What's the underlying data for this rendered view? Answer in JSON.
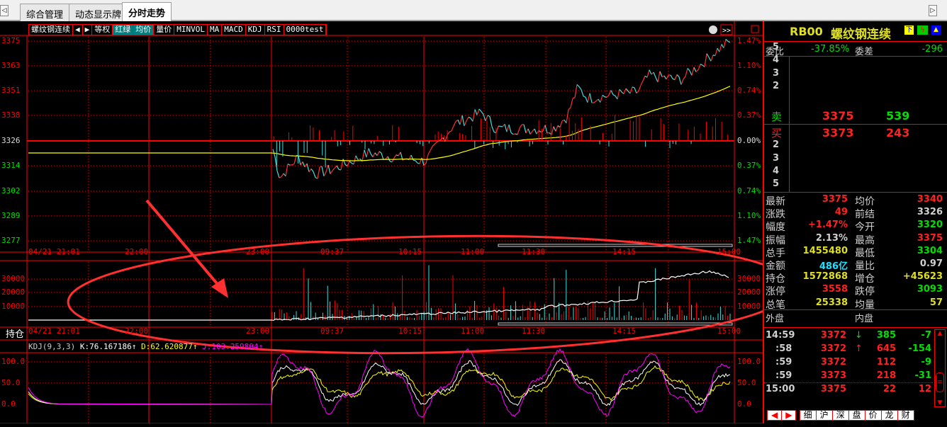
{
  "tabs": [
    "综合管理",
    "动态显示牌",
    "分时走势"
  ],
  "active_tab": 2,
  "toolbar": {
    "items": [
      "螺纹钢连续",
      "◀",
      "▶",
      "等权",
      "红绿",
      "均价",
      "量价",
      "MINVOL",
      "MA",
      "MACD",
      "KDJ",
      "RSI",
      "0000test"
    ]
  },
  "price_axis": {
    "left": [
      "3375",
      "3363",
      "3351",
      "3338",
      "3326",
      "3314",
      "3302",
      "3289",
      "3277"
    ],
    "right": [
      "1.47%",
      "1.10%",
      "0.74%",
      "0.37%",
      "0.00%",
      "0.37%",
      "0.74%",
      "1.10%",
      "1.47%"
    ]
  },
  "time_axis": [
    "04/21 21:01",
    "22:00",
    "23:00",
    "09:37",
    "10:15",
    "11:00",
    "11:30",
    "14:15",
    "15:00"
  ],
  "volume_axis": [
    "30000",
    "20000",
    "10000"
  ],
  "volume_label": "持仓",
  "kdj": {
    "title": "KDJ(9,3,3)",
    "k": "K:76.167186",
    "d": "D:62.620877",
    "j": "J:103.259804",
    "axis": [
      "100.0",
      "50.0",
      "0.0"
    ]
  },
  "quote": {
    "code": "RB00",
    "name": "螺纹钢连续",
    "wei_bi_label": "委比",
    "wei_bi": "-37.85%",
    "wei_cha_label": "委差",
    "wei_cha": "-296",
    "sell_levels": [
      "5",
      "4",
      "3",
      "2"
    ],
    "sell_label": "卖",
    "sell_price": "3375",
    "sell_vol": "539",
    "buy_label": "买",
    "buy_price": "3373",
    "buy_vol": "243",
    "buy_levels": [
      "2",
      "3",
      "4",
      "5"
    ],
    "stats": [
      [
        "最新",
        "3375",
        "均价",
        "3340"
      ],
      [
        "涨跌",
        "49",
        "前结",
        "3326"
      ],
      [
        "幅度",
        "+1.47%",
        "今开",
        "3320"
      ],
      [
        "振幅",
        "2.13%",
        "最高",
        "3375"
      ],
      [
        "总手",
        "1455480",
        "最低",
        "3304"
      ],
      [
        "金额",
        "486亿",
        "量比",
        "0.97"
      ],
      [
        "持仓",
        "1572868",
        "增仓",
        "+45623"
      ],
      [
        "涨停",
        "3558",
        "跌停",
        "3093"
      ],
      [
        "总笔",
        "25338",
        "均量",
        "57"
      ]
    ],
    "outer_label": "外盘",
    "inner_label": "内盘",
    "ticks": [
      [
        "14:59",
        "3372",
        "↓",
        "385",
        "-7"
      ],
      [
        ":58",
        "3372",
        "↑",
        "645",
        "-154"
      ],
      [
        ":59",
        "3372",
        "",
        "112",
        "-9"
      ],
      [
        ":59",
        "3373",
        "",
        "218",
        "-31"
      ],
      [
        "15:00",
        "3375",
        "",
        "22",
        "12"
      ]
    ],
    "panel_tabs": [
      "细",
      "沪",
      "深",
      "盘",
      "价",
      "龙",
      "财"
    ]
  },
  "colors": {
    "up": "#ff2020",
    "down": "#00e000",
    "avg": "#ffff00",
    "grid": "#ff0000"
  }
}
